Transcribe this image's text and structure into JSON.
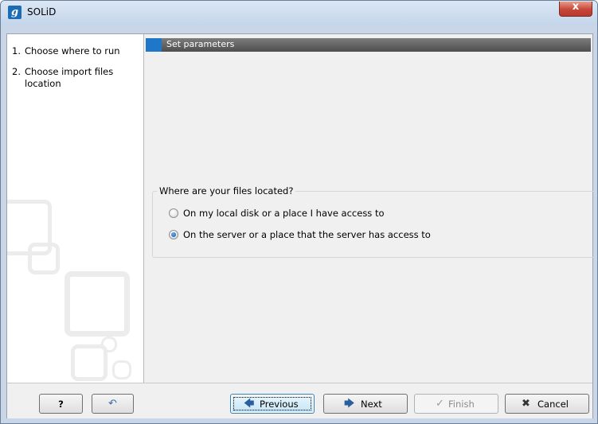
{
  "window": {
    "title": "SOLiD",
    "app_icon_letter": "g",
    "close_symbol": "x"
  },
  "steps": [
    {
      "num": "1.",
      "label": "Choose where to run"
    },
    {
      "num": "2.",
      "label": "Choose import files location"
    }
  ],
  "panel": {
    "header": "Set parameters",
    "group_title": "Where are your files located?",
    "options": [
      {
        "label": "On my local disk or a place I have access to",
        "selected": false
      },
      {
        "label": "On the server or a place that the server has access to",
        "selected": true
      }
    ]
  },
  "buttons": {
    "help": "?",
    "reset_icon": "↶",
    "previous": "Previous",
    "next": "Next",
    "finish": "Finish",
    "cancel": "Cancel",
    "previous_icon": "🡄",
    "next_icon": "🡆",
    "finish_icon": "✓",
    "cancel_icon": "✖"
  },
  "colors": {
    "header_accent": "#1f77c9",
    "close_button": "#c6473a"
  }
}
